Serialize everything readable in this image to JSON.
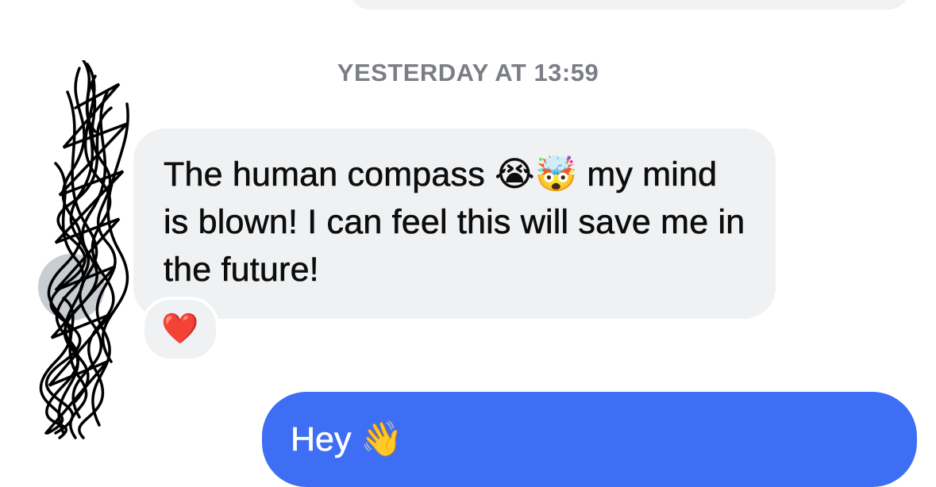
{
  "thread": {
    "timestamp": "YESTERDAY AT 13:59"
  },
  "incoming_message": {
    "text": "The human compass 😭🤯 my mind is blown! I can feel this will save me in the future!",
    "reaction_icon": "❤️",
    "reaction_color": "#e0142a",
    "bubble_color": "#eff1f3"
  },
  "outgoing_message": {
    "text": "Hey 👋",
    "bubble_color": "#3d6ef4"
  }
}
